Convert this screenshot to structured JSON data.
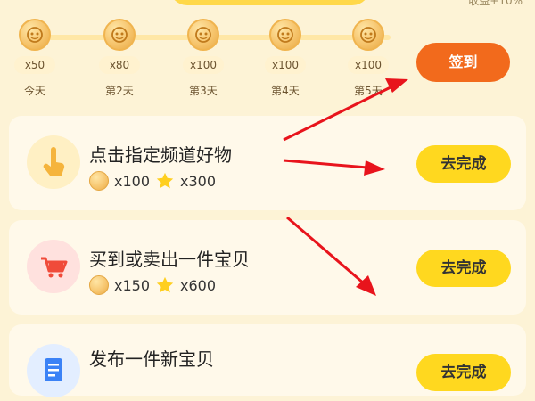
{
  "header": {
    "top_right_text": "收益+10%"
  },
  "checkin": {
    "days": [
      {
        "amount": "x50",
        "label": "今天"
      },
      {
        "amount": "x80",
        "label": "第2天"
      },
      {
        "amount": "x100",
        "label": "第3天"
      },
      {
        "amount": "x100",
        "label": "第4天"
      },
      {
        "amount": "x100",
        "label": "第5天"
      }
    ],
    "sign_in_label": "签到"
  },
  "tasks": [
    {
      "title": "点击指定频道好物",
      "coin_reward": "x100",
      "star_reward": "x300",
      "button_label": "去完成",
      "icon": "hand-pointer-icon"
    },
    {
      "title": "买到或卖出一件宝贝",
      "coin_reward": "x150",
      "star_reward": "x600",
      "button_label": "去完成",
      "icon": "shopping-cart-icon"
    },
    {
      "title": "发布一件新宝贝",
      "button_label": "去完成",
      "icon": "document-icon"
    }
  ],
  "colors": {
    "background": "#fdf3d6",
    "sign_in_button": "#f26a1c",
    "task_button": "#ffd81f",
    "arrow": "#e8141c"
  }
}
